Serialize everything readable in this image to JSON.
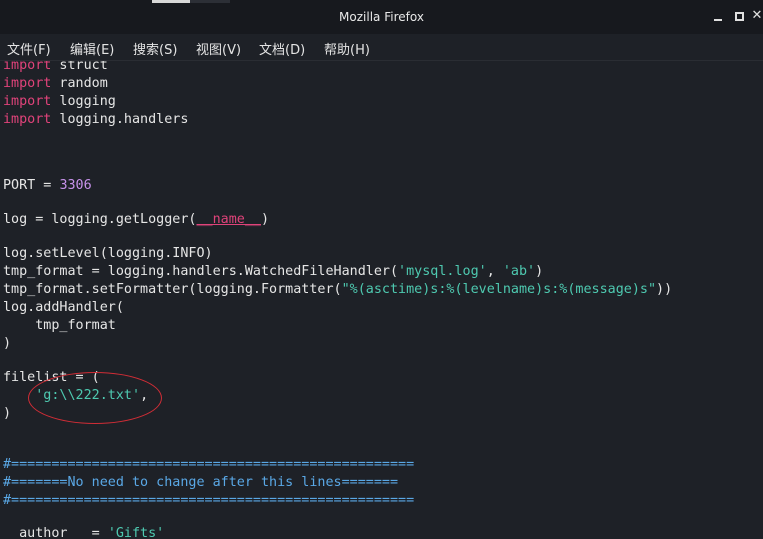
{
  "window": {
    "title": "Mozilla Firefox",
    "controls": {
      "minimize": "minimize",
      "maximize": "maximize",
      "close": "✕"
    }
  },
  "menu": [
    "文件(F)",
    "编辑(E)",
    "搜索(S)",
    "视图(V)",
    "文档(D)",
    "帮助(H)"
  ],
  "code": {
    "l1_kw": "import",
    "l1_rest": " struct",
    "l2_kw": "import",
    "l2_rest": " random",
    "l3_kw": "import",
    "l3_rest": " logging",
    "l4_kw": "import",
    "l4_rest": " logging.handlers",
    "port_pre": "PORT = ",
    "port_val": "3306",
    "log_pre": "log = logging.getLogger(",
    "log_dunder": "__name__",
    "log_post": ")",
    "setlevel": "log.setLevel(logging.INFO)",
    "tmp_pre": "tmp_format = logging.handlers.WatchedFileHandler(",
    "tmp_s1": "'mysql.log'",
    "tmp_mid": ", ",
    "tmp_s2": "'ab'",
    "tmp_post": ")",
    "fmt_pre": "tmp_format.setFormatter(logging.Formatter(",
    "fmt_str": "\"%(asctime)s:%(levelname)s:%(message)s\"",
    "fmt_post": "))",
    "addhandler": "log.addHandler(",
    "addhandler_arg": "    tmp_format",
    "close_paren": ")",
    "filelist_open": "filelist = (",
    "filelist_indent": "    ",
    "filelist_item": "'g:\\\\222.txt'",
    "filelist_comma": ",",
    "filelist_close": ")",
    "banner_top": "#==================================================",
    "banner_mid": "#=======No need to change after this lines=======",
    "banner_bot": "#==================================================",
    "author_pre": "  author   = ",
    "author_val": "'Gifts'"
  }
}
